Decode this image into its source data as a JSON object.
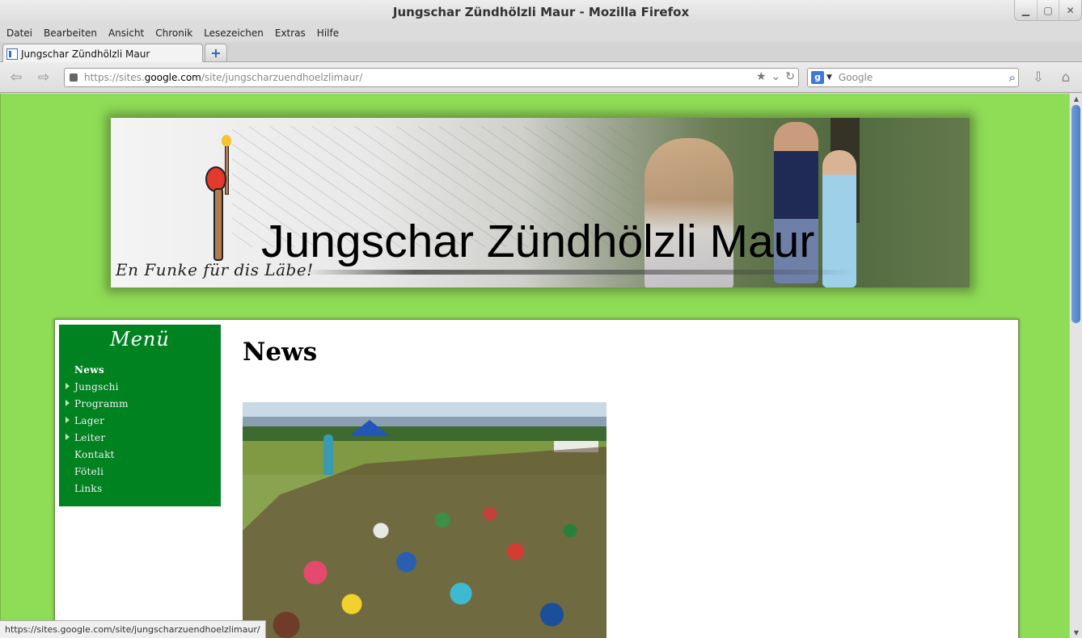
{
  "window": {
    "title": "Jungschar Zündhölzli Maur - Mozilla Firefox",
    "controls": [
      "minimize",
      "maximize",
      "close"
    ]
  },
  "menubar": [
    "Datei",
    "Bearbeiten",
    "Ansicht",
    "Chronik",
    "Lesezeichen",
    "Extras",
    "Hilfe"
  ],
  "tabs": [
    {
      "label": "Jungschar Zündhölzli Maur",
      "active": true
    }
  ],
  "urlbar": {
    "prefix": "https://sites.",
    "host": "google.com",
    "path": "/site/jungscharzuendhoelzlimaur/"
  },
  "search": {
    "engine": "Google",
    "placeholder": "Google"
  },
  "banner": {
    "site_title": "Jungschar Zündhölzli Maur",
    "tagline": "En Funke für dis Läbe!"
  },
  "sidebar": {
    "title": "Menü",
    "items": [
      {
        "label": "News",
        "active": true,
        "expandable": false
      },
      {
        "label": "Jungschi",
        "active": false,
        "expandable": true
      },
      {
        "label": "Programm",
        "active": false,
        "expandable": true
      },
      {
        "label": "Lager",
        "active": false,
        "expandable": true
      },
      {
        "label": "Leiter",
        "active": false,
        "expandable": true
      },
      {
        "label": "Kontakt",
        "active": false,
        "expandable": false
      },
      {
        "label": "Föteli",
        "active": false,
        "expandable": false
      },
      {
        "label": "Links",
        "active": false,
        "expandable": false
      }
    ]
  },
  "main": {
    "heading": "News"
  },
  "statusbar": {
    "text": "https://sites.google.com/site/jungscharzuendhoelzlimaur/"
  },
  "colors": {
    "page_background": "#8fdd56",
    "sidebar_green": "#008221"
  }
}
